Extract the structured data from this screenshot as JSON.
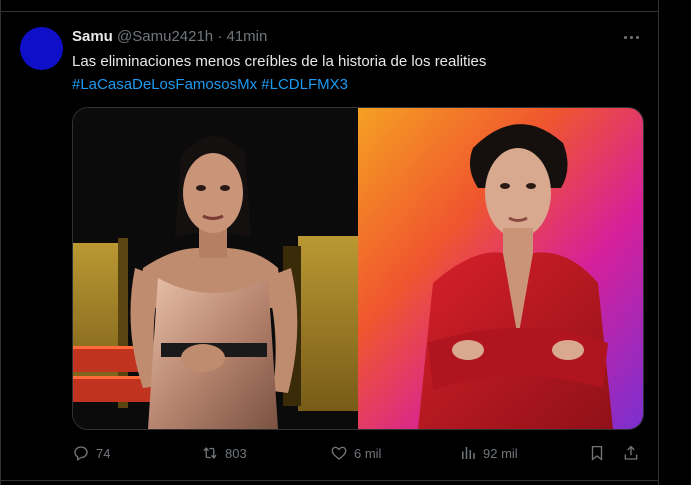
{
  "tweet": {
    "author_name": "Samu",
    "author_handle": "@Samu2421h",
    "separator": "·",
    "time": "41min",
    "text": "Las eliminaciones menos creíbles de la historia de los realities",
    "hashtags": [
      "#LaCasaDeLosFamososMx",
      "#LCDLFMX3"
    ],
    "avatar_color": "#0f0fc8"
  },
  "media": {
    "images": [
      {
        "icon": "woman-on-stage-photo",
        "palette": [
          "#0a0a0a",
          "#c9a227",
          "#b0523a"
        ]
      },
      {
        "icon": "man-red-suit-photo",
        "palette": [
          "#f06a2a",
          "#d6209a",
          "#8a2fc4",
          "#c4161c"
        ]
      }
    ]
  },
  "actions": {
    "replies": "74",
    "reposts": "803",
    "likes": "6 mil",
    "views": "92 mil"
  },
  "colors": {
    "background": "#000000",
    "text": "#e7e9ea",
    "secondary": "#71767b",
    "link": "#1d9bf0",
    "border": "#2f3336"
  }
}
